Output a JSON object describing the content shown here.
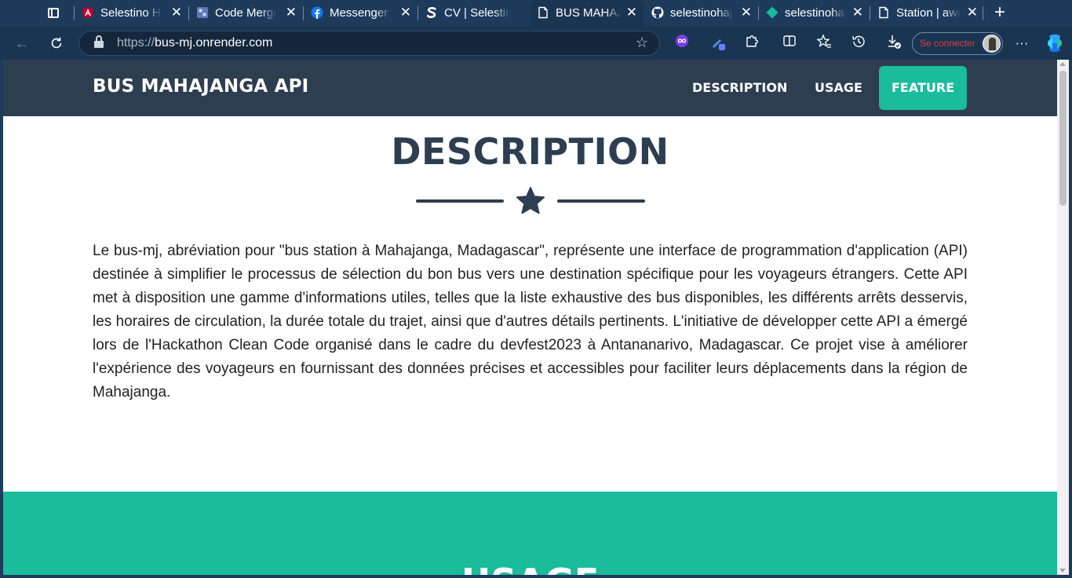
{
  "browser": {
    "tabs": [
      {
        "title": "Selestino Ha",
        "icon": "angular-icon",
        "color": "#c3002f"
      },
      {
        "title": "Code Merge",
        "icon": "code-merge-icon",
        "color": "#5a78b8"
      },
      {
        "title": "Messenger |",
        "icon": "facebook-icon",
        "color": "#1877f2"
      },
      {
        "title": "CV | Selestin",
        "icon": "s-logo-icon",
        "color": "#ffffff"
      },
      {
        "title": "BUS MAHAJA",
        "icon": "page-icon",
        "color": "#ffffff",
        "active": true
      },
      {
        "title": "selestinohaj",
        "icon": "github-icon",
        "color": "#ffffff"
      },
      {
        "title": "selestinohaj",
        "icon": "diamond-icon",
        "color": "#1abc9c"
      },
      {
        "title": "Station | awe",
        "icon": "page-icon",
        "color": "#ffffff"
      }
    ],
    "url_protocol": "https://",
    "url_host": "bus-mj.onrender.com",
    "signin_label": "Se connecter"
  },
  "site": {
    "brand": "BUS MAHAJANGA API",
    "nav": [
      "DESCRIPTION",
      "USAGE",
      "FEATURE"
    ],
    "active_nav": "FEATURE",
    "accent": "#1abc9c",
    "primary": "#2c3e50"
  },
  "description": {
    "title": "DESCRIPTION",
    "body": "Le bus-mj, abréviation pour \"bus station à Mahajanga, Madagascar\", représente une interface de programmation d'application (API) destinée à simplifier le processus de sélection du bon bus vers une destination spécifique pour les voyageurs étrangers. Cette API met à disposition une gamme d'informations utiles, telles que la liste exhaustive des bus disponibles, les différents arrêts desservis, les horaires de circulation, la durée totale du trajet, ainsi que d'autres détails pertinents. L'initiative de développer cette API a émergé lors de l'Hackathon Clean Code organisé dans le cadre du devfest2023 à Antananarivo, Madagascar. Ce projet vise à améliorer l'expérience des voyageurs en fournissant des données précises et accessibles pour faciliter leurs déplacements dans la région de Mahajanga."
  },
  "usage": {
    "title": "USAGE"
  }
}
